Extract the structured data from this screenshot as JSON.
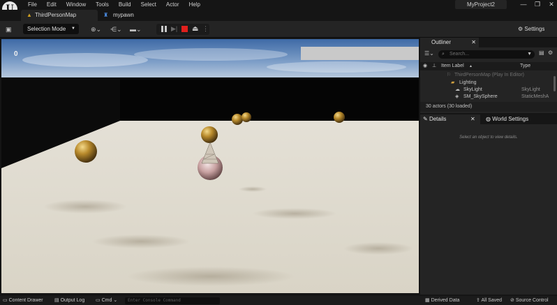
{
  "app": {
    "logo_letter": "U",
    "menu": [
      "File",
      "Edit",
      "Window",
      "Tools",
      "Build",
      "Select",
      "Actor",
      "Help"
    ],
    "project_name": "MyProject2",
    "window_buttons": [
      "—",
      "❐",
      "✕"
    ]
  },
  "tabs": [
    {
      "label": "ThirdPersonMap",
      "icon": "level-icon"
    },
    {
      "label": "mypawn",
      "icon": "blueprint-icon"
    }
  ],
  "toolbar": {
    "mode_label": "Selection Mode",
    "settings_label": "Settings"
  },
  "viewport": {
    "fps_counter": "0"
  },
  "outliner": {
    "title": "Outliner",
    "search_placeholder": "Search...",
    "col_label": "Item Label",
    "col_type": "Type",
    "rows": [
      {
        "label": "ThirdPersonMap (Play In Editor)",
        "type": ""
      },
      {
        "label": "Lighting",
        "type": ""
      },
      {
        "label": "SkyLight",
        "type": "SkyLight"
      },
      {
        "label": "SM_SkySphere",
        "type": "StaticMeshA"
      }
    ],
    "actor_count": "30 actors (30 loaded)"
  },
  "details": {
    "title": "Details",
    "world_settings": "World Settings",
    "hint": "Select an object to view details."
  },
  "statusbar": {
    "content_drawer": "Content Drawer",
    "output_log": "Output Log",
    "cmd": "Cmd",
    "console_placeholder": "Enter Console Command",
    "derived_data": "Derived Data",
    "all_saved": "All Saved",
    "source_control": "Source Control"
  },
  "colors": {
    "accent_stop": "#e0201d",
    "level_icon": "#d0a020",
    "blueprint_icon": "#4a8ae0"
  }
}
